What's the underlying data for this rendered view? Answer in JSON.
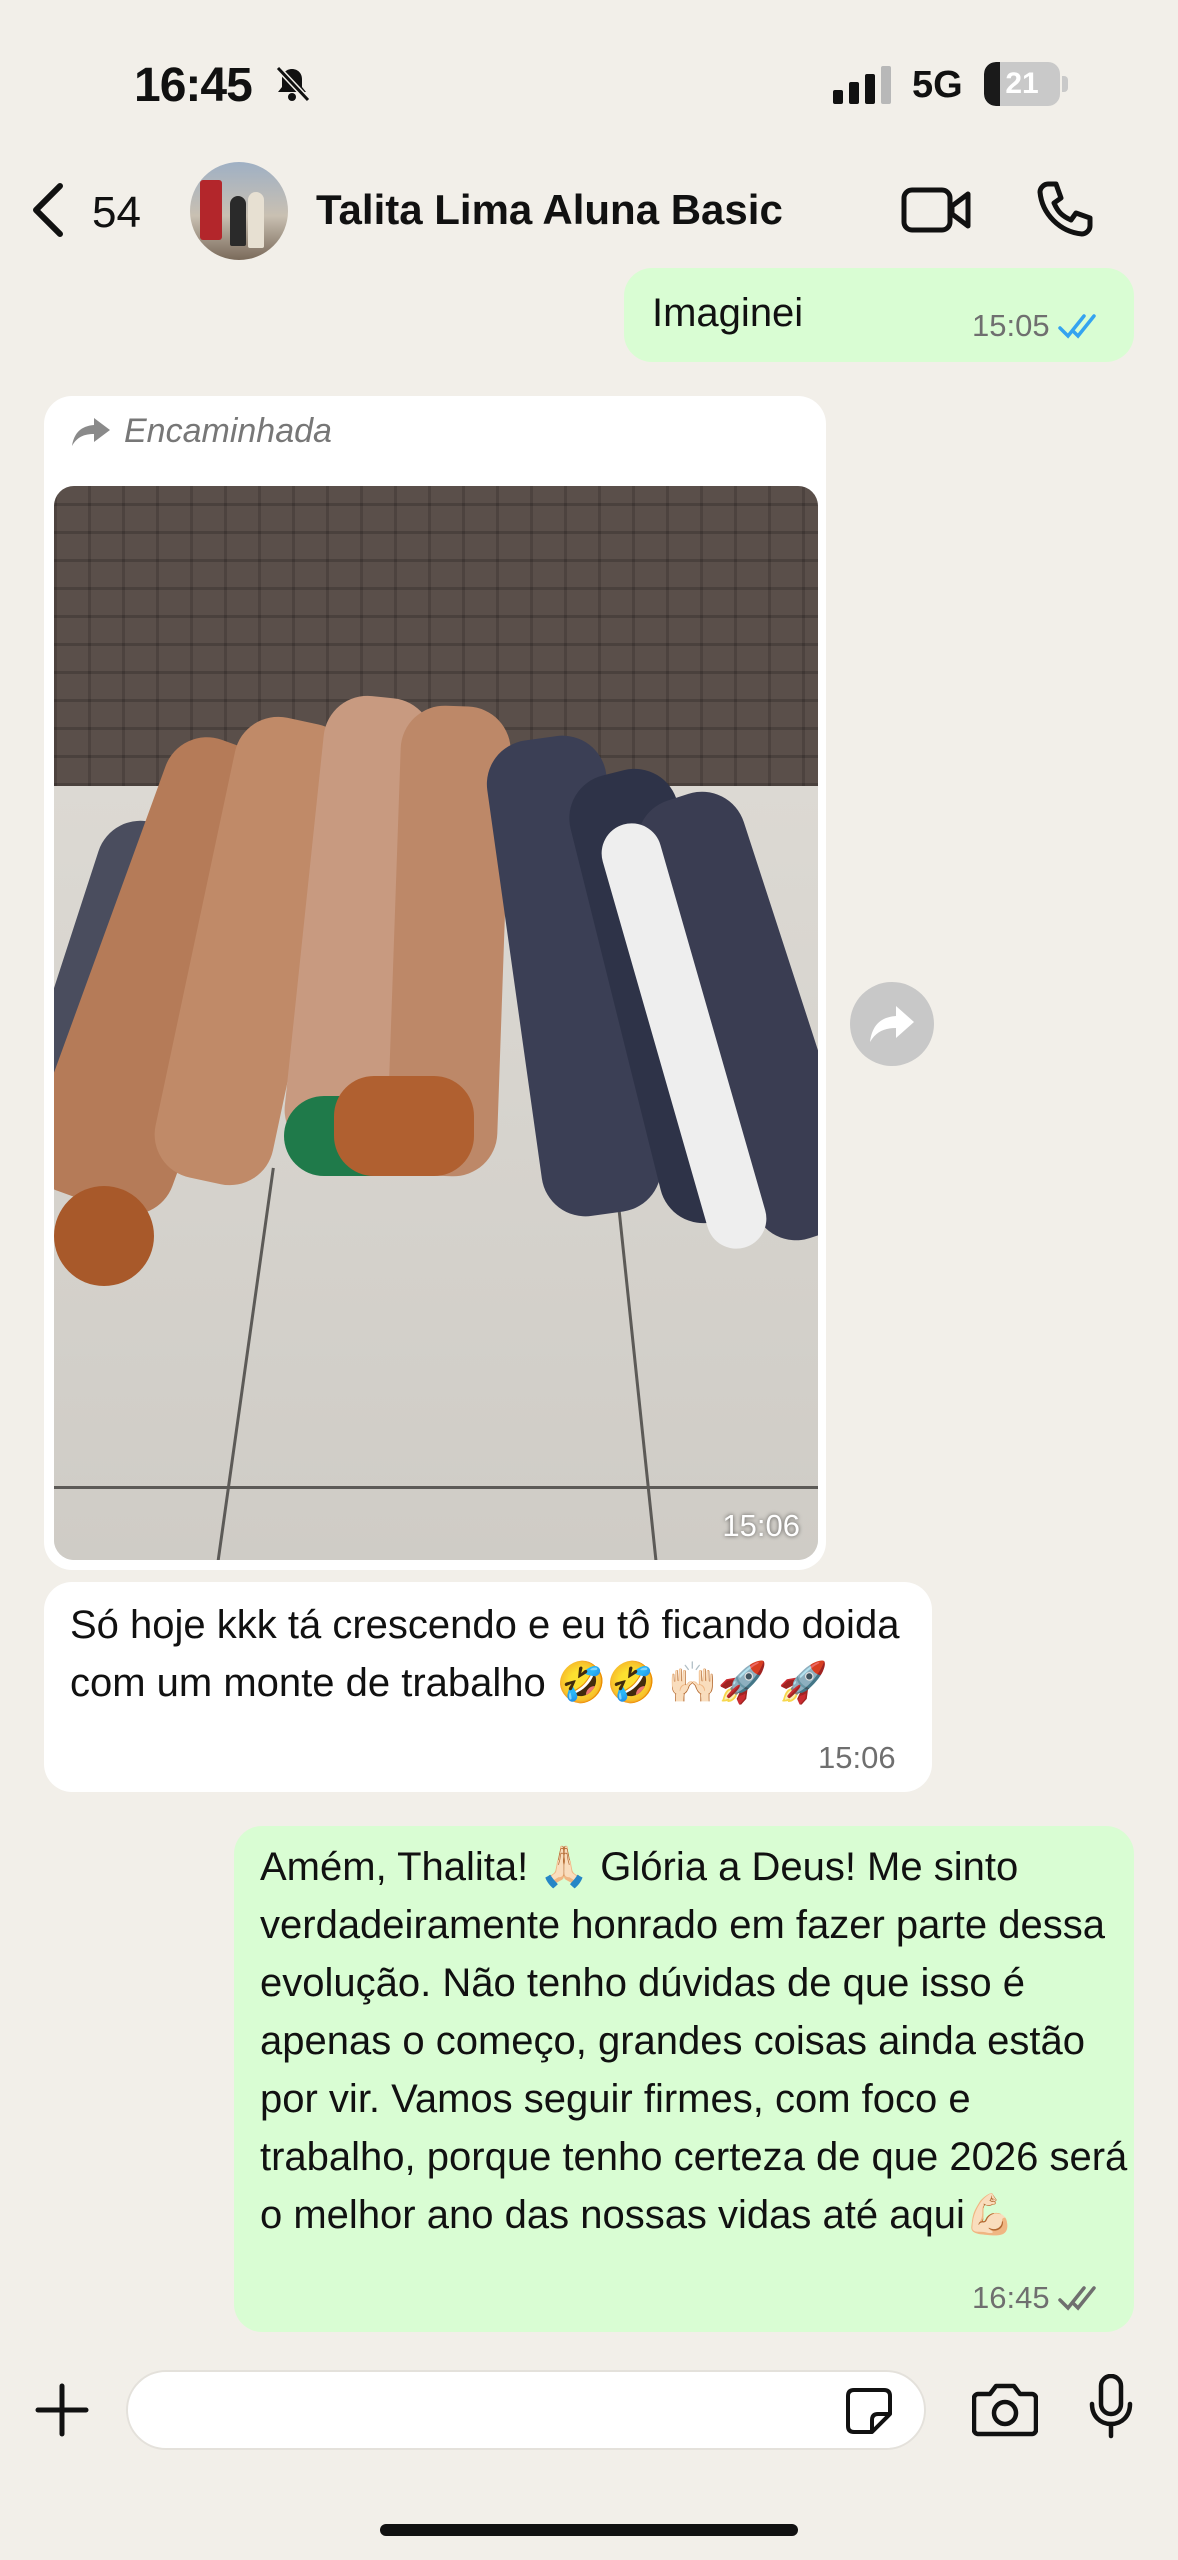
{
  "status_bar": {
    "time": "16:45",
    "network": "5G",
    "battery": "21",
    "battery_level": 0.21
  },
  "header": {
    "back_count": "54",
    "contact_name": "Talita Lima Aluna Basic"
  },
  "messages": [
    {
      "direction": "outgoing",
      "text": "Imaginei",
      "time": "15:05",
      "status": "read"
    },
    {
      "direction": "incoming",
      "forwarded_label": "Encaminhada",
      "type": "image",
      "time": "15:06"
    },
    {
      "direction": "incoming",
      "text": "Só hoje kkk tá crescendo e eu tô ficando doida com um monte de trabalho 🤣🤣 🙌🏻🚀 🚀",
      "time": "15:06"
    },
    {
      "direction": "outgoing",
      "text": "Amém, Thalita! 🙏🏻 Glória a Deus! Me sinto verdadeiramente honrado em fazer parte dessa evolução. Não tenho dúvidas de que isso é apenas o começo, grandes coisas ainda estão por vir. Vamos seguir firmes, com foco e trabalho, porque tenho certeza de que 2026 será o melhor ano das nossas vidas até aqui💪🏻",
      "time": "16:45",
      "status": "delivered"
    }
  ],
  "composer": {
    "value": "",
    "placeholder": ""
  },
  "colors": {
    "background": "#f2efe9",
    "outgoing_bubble": "#d9fdd3",
    "incoming_bubble": "#ffffff",
    "read_check": "#34a3f0",
    "delivered_check": "#6f6f6f"
  }
}
